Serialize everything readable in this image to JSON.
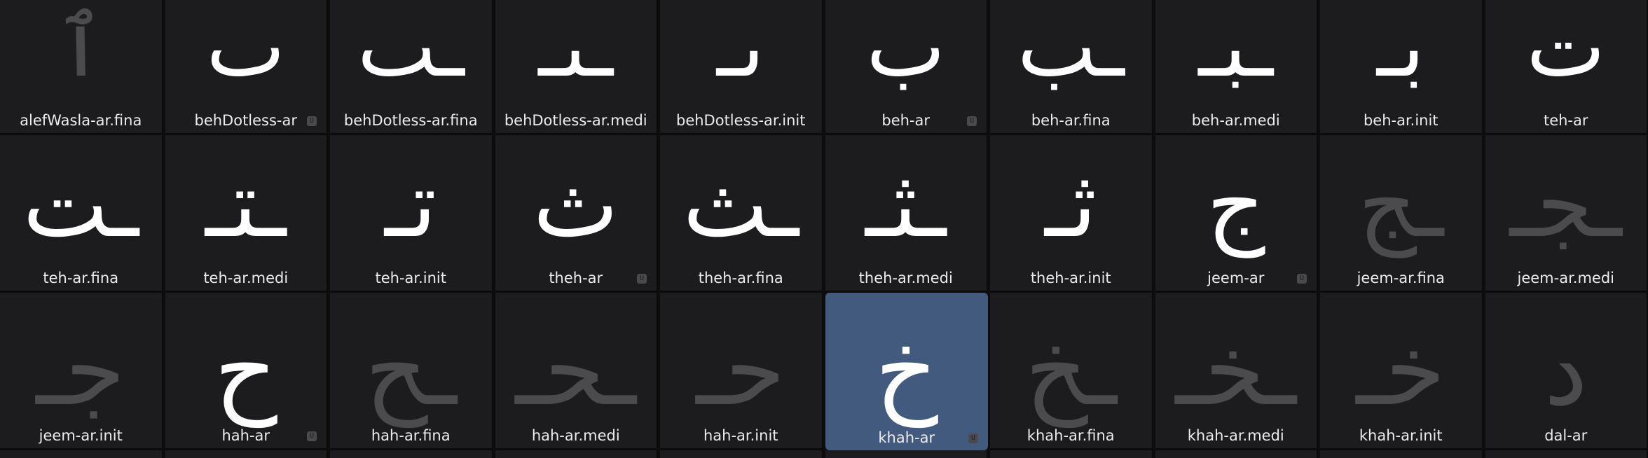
{
  "rows": [
    [
      {
        "name": "alefWasla-ar.fina",
        "glyph": "ٱ",
        "dim": true,
        "badge": false
      },
      {
        "name": "behDotless-ar",
        "glyph": "ٮ",
        "dim": false,
        "badge": true
      },
      {
        "name": "behDotless-ar.fina",
        "glyph": "ـٮ",
        "dim": false,
        "badge": false
      },
      {
        "name": "behDotless-ar.medi",
        "glyph": "ـٮـ",
        "dim": false,
        "badge": false
      },
      {
        "name": "behDotless-ar.init",
        "glyph": "ٮـ",
        "dim": false,
        "badge": false
      },
      {
        "name": "beh-ar",
        "glyph": "ب",
        "dim": false,
        "badge": true
      },
      {
        "name": "beh-ar.fina",
        "glyph": "ـب",
        "dim": false,
        "badge": false
      },
      {
        "name": "beh-ar.medi",
        "glyph": "ـبـ",
        "dim": false,
        "badge": false
      },
      {
        "name": "beh-ar.init",
        "glyph": "بـ",
        "dim": false,
        "badge": false
      },
      {
        "name": "teh-ar",
        "glyph": "ت",
        "dim": false,
        "badge": false
      }
    ],
    [
      {
        "name": "teh-ar.fina",
        "glyph": "ـت",
        "dim": false,
        "badge": false
      },
      {
        "name": "teh-ar.medi",
        "glyph": "ـتـ",
        "dim": false,
        "badge": false
      },
      {
        "name": "teh-ar.init",
        "glyph": "تـ",
        "dim": false,
        "badge": false
      },
      {
        "name": "theh-ar",
        "glyph": "ث",
        "dim": false,
        "badge": true
      },
      {
        "name": "theh-ar.fina",
        "glyph": "ـث",
        "dim": false,
        "badge": false
      },
      {
        "name": "theh-ar.medi",
        "glyph": "ـثـ",
        "dim": false,
        "badge": false
      },
      {
        "name": "theh-ar.init",
        "glyph": "ثـ",
        "dim": false,
        "badge": false
      },
      {
        "name": "jeem-ar",
        "glyph": "ج",
        "dim": false,
        "badge": true
      },
      {
        "name": "jeem-ar.fina",
        "glyph": "ـج",
        "dim": true,
        "badge": false
      },
      {
        "name": "jeem-ar.medi",
        "glyph": "ـجـ",
        "dim": true,
        "badge": false
      }
    ],
    [
      {
        "name": "jeem-ar.init",
        "glyph": "جـ",
        "dim": true,
        "badge": false
      },
      {
        "name": "hah-ar",
        "glyph": "ح",
        "dim": false,
        "badge": true
      },
      {
        "name": "hah-ar.fina",
        "glyph": "ـح",
        "dim": true,
        "badge": false
      },
      {
        "name": "hah-ar.medi",
        "glyph": "ـحـ",
        "dim": true,
        "badge": false
      },
      {
        "name": "hah-ar.init",
        "glyph": "حـ",
        "dim": true,
        "badge": false
      },
      {
        "name": "khah-ar",
        "glyph": "خ",
        "dim": false,
        "badge": true,
        "selected": true
      },
      {
        "name": "khah-ar.fina",
        "glyph": "ـخ",
        "dim": true,
        "badge": false
      },
      {
        "name": "khah-ar.medi",
        "glyph": "ـخـ",
        "dim": true,
        "badge": false
      },
      {
        "name": "khah-ar.init",
        "glyph": "خـ",
        "dim": true,
        "badge": false
      },
      {
        "name": "dal-ar",
        "glyph": "د",
        "dim": true,
        "badge": false
      }
    ]
  ],
  "badge_glyph": "U",
  "colors": {
    "cell_bg": "#1c1c1e",
    "selected_bg": "#415a7e",
    "glyph_bright": "#ffffff",
    "glyph_dim": "#4b4b4d",
    "label": "#ececec"
  }
}
